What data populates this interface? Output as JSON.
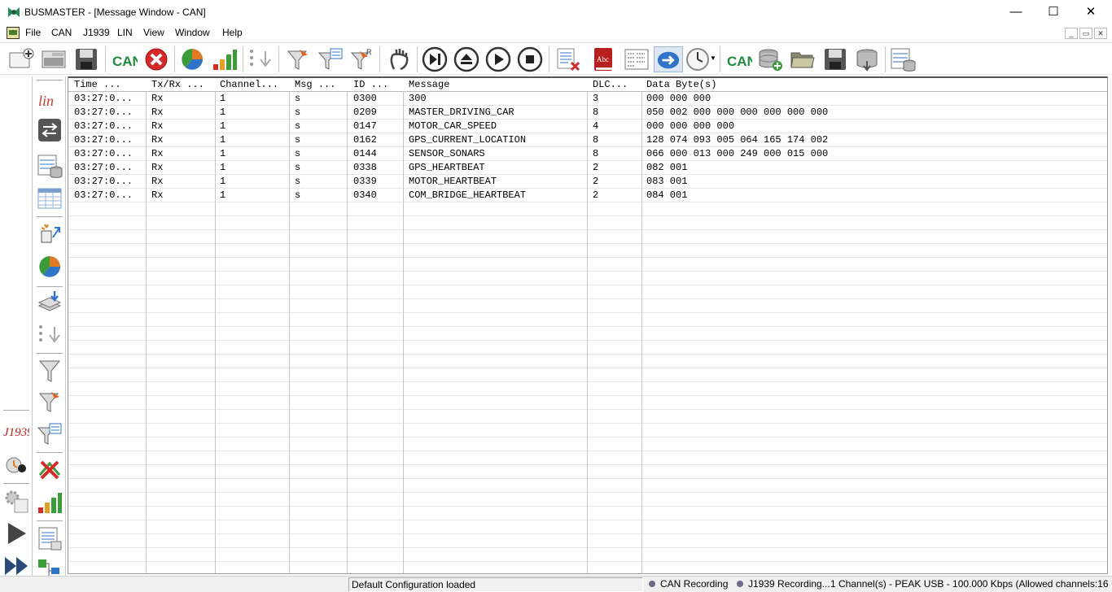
{
  "window": {
    "title": "BUSMASTER - [Message Window - CAN]",
    "minimize_glyph": "—",
    "maximize_glyph": "☐",
    "close_glyph": "✕"
  },
  "menu": {
    "items": [
      "File",
      "CAN",
      "J1939",
      "LIN",
      "View",
      "Window",
      "Help"
    ],
    "mdi_minimize": "_",
    "mdi_restore": "▭",
    "mdi_close": "✕"
  },
  "toolbar": {
    "can_label_1": "CAN",
    "can_label_2": "CAN",
    "lin_label": "lin",
    "j1939_label": "J1939",
    "abc_label": "Abc"
  },
  "grid": {
    "columns": [
      "Time",
      "Tx/Rx",
      "Channel",
      "Msg",
      "ID",
      "Message",
      "DLC",
      "Data Byte(s)"
    ],
    "column_header_display": [
      "Time     ...",
      "Tx/Rx ...",
      "Channel...",
      "Msg ...",
      "ID  ...",
      "Message",
      "DLC...",
      "Data Byte(s)"
    ],
    "rows": [
      [
        "03:27:0...",
        "Rx",
        "1",
        "s",
        "0300",
        "300",
        "3",
        "000 000 000"
      ],
      [
        "03:27:0...",
        "Rx",
        "1",
        "s",
        "0209",
        "MASTER_DRIVING_CAR",
        "8",
        "050 002 000 000 000 000 000 000"
      ],
      [
        "03:27:0...",
        "Rx",
        "1",
        "s",
        "0147",
        "MOTOR_CAR_SPEED",
        "4",
        "000 000 000 000"
      ],
      [
        "03:27:0...",
        "Rx",
        "1",
        "s",
        "0162",
        "GPS_CURRENT_LOCATION",
        "8",
        "128 074 093 005 064 165 174 002"
      ],
      [
        "03:27:0...",
        "Rx",
        "1",
        "s",
        "0144",
        "SENSOR_SONARS",
        "8",
        "066 000 013 000 249 000 015 000"
      ],
      [
        "03:27:0...",
        "Rx",
        "1",
        "s",
        "0338",
        "GPS_HEARTBEAT",
        "2",
        "082 001"
      ],
      [
        "03:27:0...",
        "Rx",
        "1",
        "s",
        "0339",
        "MOTOR_HEARTBEAT",
        "2",
        "083 001"
      ],
      [
        "03:27:0...",
        "Rx",
        "1",
        "s",
        "0340",
        "COM_BRIDGE_HEARTBEAT",
        "2",
        "084 001"
      ]
    ]
  },
  "status": {
    "config": "Default Configuration loaded",
    "can_recording": "CAN Recording",
    "j1939_recording": "J1939 Recording...",
    "channel_info": "1 Channel(s) - PEAK USB - 100.000 Kbps (Allowed channels:16"
  },
  "colors": {
    "can_green": "#1f8a3c",
    "stop_red": "#d42a2a",
    "lin_red": "#c0392b",
    "j1939_red": "#b22222",
    "accent_blue": "#2f74c8"
  }
}
